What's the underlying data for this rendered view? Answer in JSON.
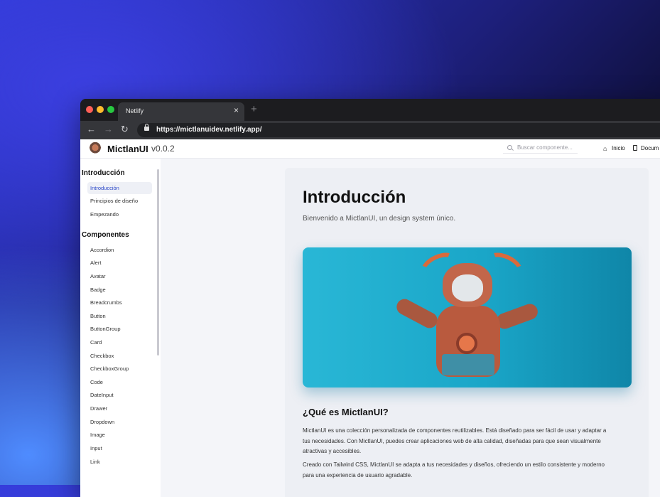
{
  "browser": {
    "tab_title": "Netlify",
    "tab_close": "×",
    "new_tab": "+",
    "url": "https://mictlanuidev.netlify.app/",
    "nav": {
      "back": "←",
      "forward": "→",
      "reload": "↻"
    }
  },
  "header": {
    "logo": "MictlanUI",
    "version": "v0.0.2",
    "search_placeholder": "Buscar componente...",
    "links": {
      "home": "Inicio",
      "docs": "Docum"
    }
  },
  "sidebar": {
    "sections": [
      {
        "title": "Introducción",
        "items": [
          "Introducción",
          "Principios de diseño",
          "Empezando"
        ]
      },
      {
        "title": "Componentes",
        "items": [
          "Accordion",
          "Alert",
          "Avatar",
          "Badge",
          "Breadcrumbs",
          "Button",
          "ButtonGroup",
          "Card",
          "Checkbox",
          "CheckboxGroup",
          "Code",
          "DateInput",
          "Drawer",
          "Dropdown",
          "Image",
          "Input",
          "Link"
        ]
      }
    ],
    "active_item": "Introducción"
  },
  "main": {
    "title": "Introducción",
    "subtitle": "Bienvenido a MictlanUI, un design system único.",
    "section_title": "¿Qué es MictlanUI?",
    "paragraphs": [
      [
        "MictlanUI es una colección personalizada de componentes reutilizables. Está diseñado para ser fácil de usar y adaptar a",
        "tus necesidades. Con MictlanUI, puedes crear aplicaciones web de alta calidad, diseñadas para que sean visualmente",
        "atractivas y accesibles."
      ],
      [
        "Creado con Tailwind CSS, MictlanUI se adapta a tus necesidades y diseños, ofreciendo un estilo consistente y moderno",
        "para una experiencia de usuario agradable."
      ]
    ]
  },
  "colors": {
    "accent": "#2a47c8",
    "hero": "#1aa6c8"
  }
}
